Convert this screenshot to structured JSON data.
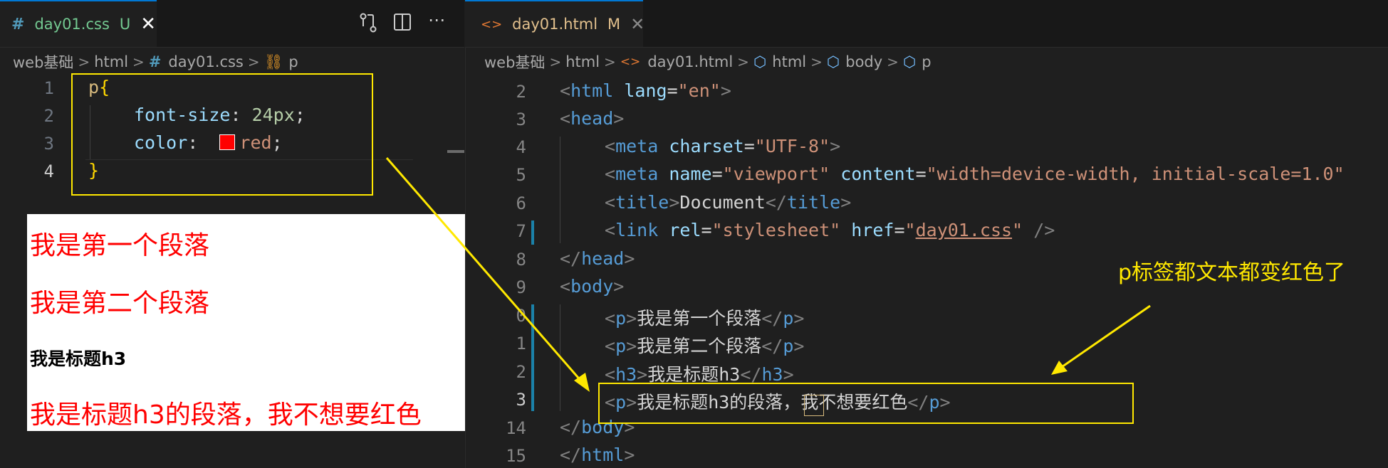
{
  "left_editor": {
    "tab": {
      "icon": "css-hash-icon",
      "filename": "day01.css",
      "badge": "U",
      "close_icon": "close-icon"
    },
    "actions": [
      "open-changes-icon",
      "split-editor-icon",
      "more-actions-icon"
    ],
    "breadcrumb": [
      "web基础",
      "html",
      "day01.css",
      "p"
    ],
    "lines": [
      {
        "num": "1",
        "selector": "p",
        "brace": "{"
      },
      {
        "num": "2",
        "prop": "font-size",
        "value": "24px"
      },
      {
        "num": "3",
        "prop": "color",
        "value": "red",
        "swatch": "#ff0000"
      },
      {
        "num": "4",
        "brace": "}"
      }
    ]
  },
  "preview": {
    "p1": "我是第一个段落",
    "p2": "我是第二个段落",
    "h3": "我是标题h3",
    "p3": "我是标题h3的段落，我不想要红色"
  },
  "right_editor": {
    "tab": {
      "icon": "html-angle-icon",
      "filename": "day01.html",
      "badge": "M",
      "close_icon": "close-icon"
    },
    "breadcrumb": [
      "web基础",
      "html",
      "day01.html",
      "html",
      "body",
      "p"
    ],
    "line_numbers": [
      "2",
      "3",
      "4",
      "5",
      "6",
      "7",
      "8",
      "9",
      "0",
      "1",
      "2",
      "3",
      "14",
      "15"
    ],
    "code": {
      "l2_attr_val": "\"en\"",
      "l4_charset": "\"UTF-8\"",
      "l5_name": "\"viewport\"",
      "l5_content": "\"width=device-width, initial-scale=1.0\"",
      "l6_title": "Document",
      "l7_rel": "\"stylesheet\"",
      "l7_href": "day01.css",
      "p1_text": "我是第一个段落",
      "p2_text": "我是第二个段落",
      "h3_text": "我是标题h3",
      "p3_text_a": "我是标题h3的段落",
      "p3_comma": "，",
      "p3_text_b": "我不想要红色"
    },
    "annotation": "p标签都文本都变红色了"
  },
  "colors": {
    "highlight": "#ffe800",
    "red_text": "#ff0000",
    "tab_accent": "#0078d4"
  }
}
